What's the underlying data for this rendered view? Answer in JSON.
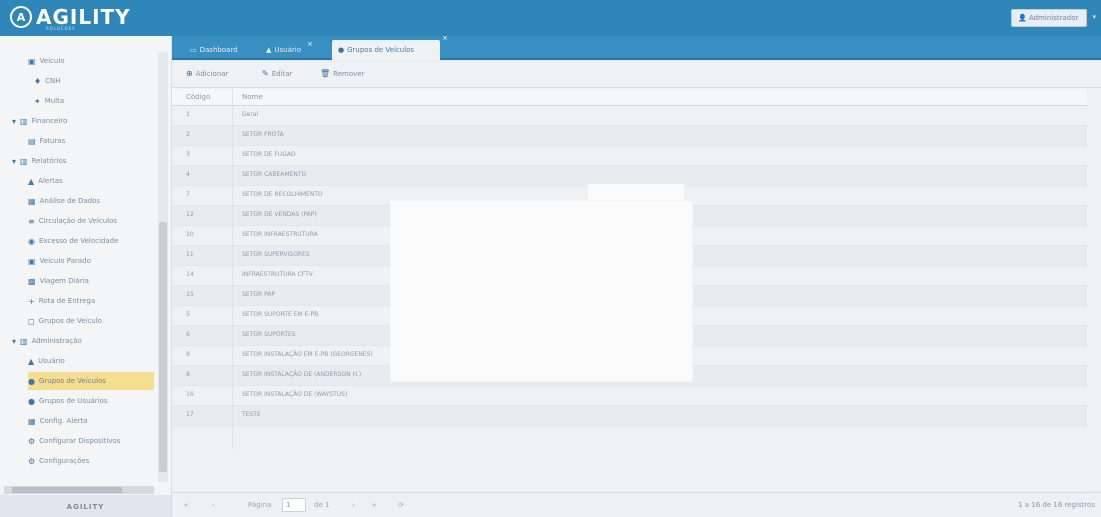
{
  "header": {
    "logo_mark": "A",
    "logo_text": "AGILITY",
    "logo_sub": "SOLUCOES",
    "user_label": "Administrador",
    "colors": {
      "header": "#2f86b9",
      "selected_row": "#f6de91"
    }
  },
  "tabs": [
    {
      "label": "Dashboard",
      "icon": "monitor-icon"
    },
    {
      "label": "Usuário",
      "icon": "user-icon"
    },
    {
      "label": "Grupos de Veículos",
      "icon": "dot-icon"
    }
  ],
  "sidebar": {
    "items": [
      {
        "label": "Veículo",
        "icon": "car-icon"
      },
      {
        "label": "CNH",
        "icon": "pin-icon"
      },
      {
        "label": "Multa",
        "icon": "wrench-icon"
      },
      {
        "label": "Financeiro",
        "icon": "chart-icon"
      },
      {
        "label": "Faturas",
        "icon": "invoice-icon"
      },
      {
        "label": "Relatórios",
        "icon": "chart-icon"
      },
      {
        "label": "Alertas",
        "icon": "warning-icon"
      },
      {
        "label": "Análise de Dados",
        "icon": "report-icon"
      },
      {
        "label": "Circulação de Veículos",
        "icon": "list-icon"
      },
      {
        "label": "Excesso de Velocidade",
        "icon": "speed-icon"
      },
      {
        "label": "Veículo Parado",
        "icon": "car-icon"
      },
      {
        "label": "Viagem Diária",
        "icon": "calendar-icon"
      },
      {
        "label": "Rota de Entrega",
        "icon": "plus-icon"
      },
      {
        "label": "Grupos de Veículo",
        "icon": "group-icon"
      },
      {
        "label": "Administração",
        "icon": "admin-icon"
      },
      {
        "label": "Usuário",
        "icon": "user-icon"
      },
      {
        "label": "Grupos de Veículos",
        "icon": "dot-icon"
      },
      {
        "label": "Grupos de Usuários",
        "icon": "dot-icon"
      },
      {
        "label": "Config. Alerta",
        "icon": "config-icon"
      },
      {
        "label": "Configurar Dispositivos",
        "icon": "gear-icon"
      },
      {
        "label": "Configurações",
        "icon": "gear-icon"
      }
    ],
    "footer": "AGILITY"
  },
  "toolbar": {
    "add": "Adicionar",
    "edit": "Editar",
    "remove": "Remover"
  },
  "grid": {
    "columns": [
      "Código",
      "Nome"
    ],
    "rows": [
      [
        "1",
        "Geral"
      ],
      [
        "2",
        "SETOR FROTA"
      ],
      [
        "3",
        "SETOR DE FUGAO"
      ],
      [
        "4",
        "SETOR CABEAMENTO"
      ],
      [
        "7",
        "SETOR DE RECOLHIMENTO"
      ],
      [
        "12",
        "SETOR DE VENDAS (PAP)"
      ],
      [
        "10",
        "SETOR INFRAESTRUTURA"
      ],
      [
        "11",
        "SETOR SUPERVISORES"
      ],
      [
        "14",
        "INFRAESTRUTURA CFTV"
      ],
      [
        "15",
        "SETOR PAP"
      ],
      [
        "5",
        "SETOR SUPORTE EM E-PB"
      ],
      [
        "6",
        "SETOR SUPORTES"
      ],
      [
        "9",
        "SETOR INSTALAÇÃO EM E-PB (GEORGENES)"
      ],
      [
        "8",
        "SETOR INSTALAÇÃO DE (ANDERSON H.)"
      ],
      [
        "16",
        "SETOR INSTALAÇÃO DE (WAYSTUS)"
      ],
      [
        "17",
        "TESTE"
      ]
    ]
  },
  "pager": {
    "page_label": "Página",
    "page_value": "1",
    "of_label": "de 1",
    "info": "1 a 16 de 16 registros"
  }
}
